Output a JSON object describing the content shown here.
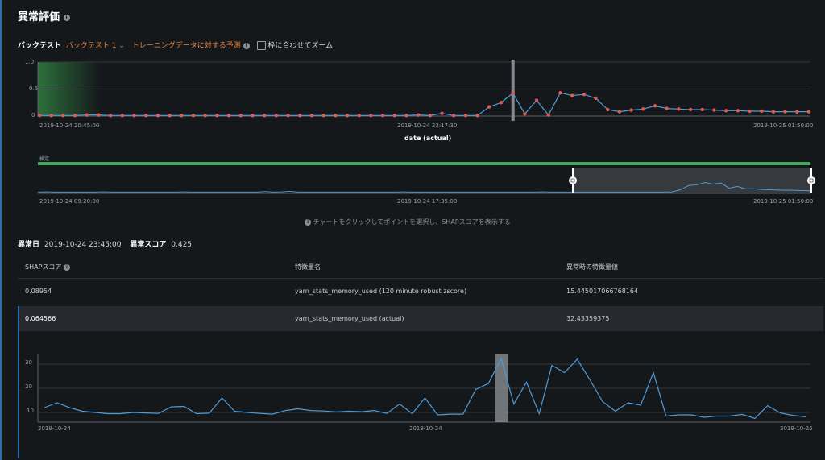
{
  "header": {
    "title": "異常評価",
    "info_icon": "info-icon"
  },
  "toolbar": {
    "backtest_label": "バックテスト",
    "backtest_select": "バックテスト 1",
    "mode_select": "トレーニングデータに対する予測",
    "zoom_label": "枠に合わせてズーム",
    "zoom_checked": false
  },
  "colors": {
    "accent": "#2a6fb0",
    "orange": "#e8823a",
    "line": "#4f9bd8",
    "point": "#e05a4f",
    "green": "#3fa65a"
  },
  "main_chart": {
    "chart_data": {
      "type": "line",
      "xlabel": "date (actual)",
      "ylim": [
        0,
        1
      ],
      "yticks": [
        "0",
        "0.5",
        "1.0"
      ],
      "xticks": [
        "2019-10-24 20:45:00",
        "2019-10-24 23:17:30",
        "2019-10-25 01:50:00"
      ],
      "series": [
        {
          "values": [
            0.01,
            0.01,
            0.01,
            0.01,
            0.02,
            0.02,
            0.01,
            0.01,
            0.01,
            0.01,
            0.01,
            0.01,
            0.01,
            0.01,
            0.01,
            0.01,
            0.01,
            0.01,
            0.01,
            0.01,
            0.01,
            0.01,
            0.01,
            0.01,
            0.01,
            0.01,
            0.01,
            0.01,
            0.01,
            0.01,
            0.01,
            0.01,
            0.02,
            0.01,
            0.05,
            0.01,
            0.01,
            0.01,
            0.17,
            0.25,
            0.425,
            0.04,
            0.29,
            0.02,
            0.43,
            0.38,
            0.4,
            0.33,
            0.12,
            0.08,
            0.11,
            0.13,
            0.19,
            0.14,
            0.13,
            0.12,
            0.12,
            0.11,
            0.1,
            0.1,
            0.09,
            0.09,
            0.08,
            0.08,
            0.08,
            0.08
          ]
        }
      ],
      "selected_index": 40
    }
  },
  "overview": {
    "band_label": "検定",
    "xticks": [
      "2019-10-24 09:20:00",
      "2019-10-24 17:35:00",
      "2019-10-25 01:50:00"
    ],
    "values": [
      0.05,
      0.06,
      0.05,
      0.05,
      0.05,
      0.05,
      0.05,
      0.05,
      0.06,
      0.05,
      0.05,
      0.05,
      0.05,
      0.05,
      0.05,
      0.05,
      0.05,
      0.05,
      0.06,
      0.05,
      0.05,
      0.05,
      0.05,
      0.05,
      0.05,
      0.05,
      0.05,
      0.05,
      0.07,
      0.05,
      0.06,
      0.08,
      0.05,
      0.05,
      0.05,
      0.05,
      0.05,
      0.05,
      0.05,
      0.05,
      0.05,
      0.05,
      0.05,
      0.05,
      0.05,
      0.06,
      0.05,
      0.05,
      0.05,
      0.05,
      0.05,
      0.05,
      0.05,
      0.05,
      0.05,
      0.05,
      0.05,
      0.05,
      0.05,
      0.05,
      0.05,
      0.05,
      0.06,
      0.05,
      0.05,
      0.05,
      0.05,
      0.05,
      0.05,
      0.05,
      0.05,
      0.05,
      0.05,
      0.05,
      0.05,
      0.05,
      0.05,
      0.05,
      0.06,
      0.14,
      0.3,
      0.33,
      0.42,
      0.36,
      0.4,
      0.2,
      0.27,
      0.18,
      0.18,
      0.15,
      0.14,
      0.13,
      0.12,
      0.12,
      0.11,
      0.1
    ]
  },
  "hint": "チャートをクリックしてポイントを選択し、SHAPスコアを表示する",
  "summary": {
    "date_label": "異常日",
    "date_value": "2019-10-24 23:45:00",
    "score_label": "異常スコア",
    "score_value": "0.425"
  },
  "table": {
    "headers": [
      "SHAPスコア",
      "特徴量名",
      "異常時の特徴量値"
    ],
    "rows": [
      [
        "0.08954",
        "yarn_stats_memory_used (120 minute robust zscore)",
        "15.445017066768164"
      ],
      [
        "0.064566",
        "yarn_stats_memory_used (actual)",
        "32.43359375"
      ]
    ]
  },
  "detail_chart": {
    "chart_data": {
      "type": "line",
      "ylim": [
        6,
        34
      ],
      "yticks": [
        "10",
        "20",
        "30"
      ],
      "xticks": [
        "2019-10-24",
        "2019-10-24",
        "2019-10-25"
      ],
      "series": [
        {
          "values": [
            12,
            14,
            12,
            10.5,
            10,
            9.5,
            9.5,
            10,
            9.8,
            9.6,
            12.3,
            12.5,
            9.5,
            9.7,
            16,
            10.5,
            10,
            9.6,
            9.3,
            10.8,
            11.5,
            10.8,
            10.6,
            10.2,
            10.5,
            10.3,
            10.8,
            9.6,
            13.5,
            9.5,
            16,
            9,
            9.3,
            9.3,
            19.5,
            22,
            32.4,
            13.5,
            22.5,
            9.5,
            29.5,
            26.5,
            32,
            23.5,
            14.5,
            10.5,
            14,
            13,
            26.5,
            8.5,
            9,
            9,
            8,
            8.5,
            8.5,
            9.2,
            7.5,
            12.8,
            9.8,
            8.8,
            8.2
          ]
        }
      ],
      "selected_index": 36
    }
  }
}
